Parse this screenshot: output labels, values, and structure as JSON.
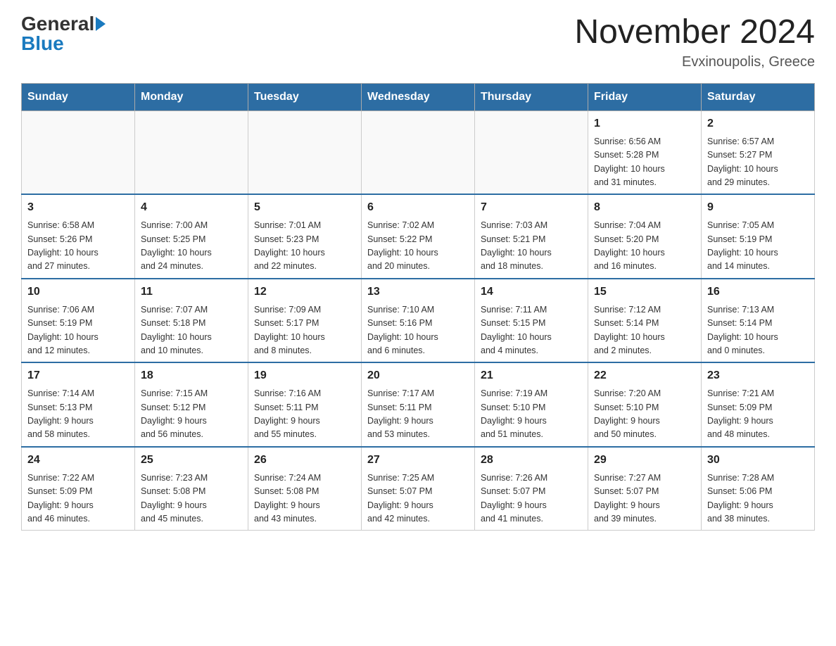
{
  "header": {
    "logo_general": "General",
    "logo_blue": "Blue",
    "month_year": "November 2024",
    "location": "Evxinoupolis, Greece"
  },
  "weekdays": [
    "Sunday",
    "Monday",
    "Tuesday",
    "Wednesday",
    "Thursday",
    "Friday",
    "Saturday"
  ],
  "weeks": [
    [
      {
        "day": "",
        "info": ""
      },
      {
        "day": "",
        "info": ""
      },
      {
        "day": "",
        "info": ""
      },
      {
        "day": "",
        "info": ""
      },
      {
        "day": "",
        "info": ""
      },
      {
        "day": "1",
        "info": "Sunrise: 6:56 AM\nSunset: 5:28 PM\nDaylight: 10 hours\nand 31 minutes."
      },
      {
        "day": "2",
        "info": "Sunrise: 6:57 AM\nSunset: 5:27 PM\nDaylight: 10 hours\nand 29 minutes."
      }
    ],
    [
      {
        "day": "3",
        "info": "Sunrise: 6:58 AM\nSunset: 5:26 PM\nDaylight: 10 hours\nand 27 minutes."
      },
      {
        "day": "4",
        "info": "Sunrise: 7:00 AM\nSunset: 5:25 PM\nDaylight: 10 hours\nand 24 minutes."
      },
      {
        "day": "5",
        "info": "Sunrise: 7:01 AM\nSunset: 5:23 PM\nDaylight: 10 hours\nand 22 minutes."
      },
      {
        "day": "6",
        "info": "Sunrise: 7:02 AM\nSunset: 5:22 PM\nDaylight: 10 hours\nand 20 minutes."
      },
      {
        "day": "7",
        "info": "Sunrise: 7:03 AM\nSunset: 5:21 PM\nDaylight: 10 hours\nand 18 minutes."
      },
      {
        "day": "8",
        "info": "Sunrise: 7:04 AM\nSunset: 5:20 PM\nDaylight: 10 hours\nand 16 minutes."
      },
      {
        "day": "9",
        "info": "Sunrise: 7:05 AM\nSunset: 5:19 PM\nDaylight: 10 hours\nand 14 minutes."
      }
    ],
    [
      {
        "day": "10",
        "info": "Sunrise: 7:06 AM\nSunset: 5:19 PM\nDaylight: 10 hours\nand 12 minutes."
      },
      {
        "day": "11",
        "info": "Sunrise: 7:07 AM\nSunset: 5:18 PM\nDaylight: 10 hours\nand 10 minutes."
      },
      {
        "day": "12",
        "info": "Sunrise: 7:09 AM\nSunset: 5:17 PM\nDaylight: 10 hours\nand 8 minutes."
      },
      {
        "day": "13",
        "info": "Sunrise: 7:10 AM\nSunset: 5:16 PM\nDaylight: 10 hours\nand 6 minutes."
      },
      {
        "day": "14",
        "info": "Sunrise: 7:11 AM\nSunset: 5:15 PM\nDaylight: 10 hours\nand 4 minutes."
      },
      {
        "day": "15",
        "info": "Sunrise: 7:12 AM\nSunset: 5:14 PM\nDaylight: 10 hours\nand 2 minutes."
      },
      {
        "day": "16",
        "info": "Sunrise: 7:13 AM\nSunset: 5:14 PM\nDaylight: 10 hours\nand 0 minutes."
      }
    ],
    [
      {
        "day": "17",
        "info": "Sunrise: 7:14 AM\nSunset: 5:13 PM\nDaylight: 9 hours\nand 58 minutes."
      },
      {
        "day": "18",
        "info": "Sunrise: 7:15 AM\nSunset: 5:12 PM\nDaylight: 9 hours\nand 56 minutes."
      },
      {
        "day": "19",
        "info": "Sunrise: 7:16 AM\nSunset: 5:11 PM\nDaylight: 9 hours\nand 55 minutes."
      },
      {
        "day": "20",
        "info": "Sunrise: 7:17 AM\nSunset: 5:11 PM\nDaylight: 9 hours\nand 53 minutes."
      },
      {
        "day": "21",
        "info": "Sunrise: 7:19 AM\nSunset: 5:10 PM\nDaylight: 9 hours\nand 51 minutes."
      },
      {
        "day": "22",
        "info": "Sunrise: 7:20 AM\nSunset: 5:10 PM\nDaylight: 9 hours\nand 50 minutes."
      },
      {
        "day": "23",
        "info": "Sunrise: 7:21 AM\nSunset: 5:09 PM\nDaylight: 9 hours\nand 48 minutes."
      }
    ],
    [
      {
        "day": "24",
        "info": "Sunrise: 7:22 AM\nSunset: 5:09 PM\nDaylight: 9 hours\nand 46 minutes."
      },
      {
        "day": "25",
        "info": "Sunrise: 7:23 AM\nSunset: 5:08 PM\nDaylight: 9 hours\nand 45 minutes."
      },
      {
        "day": "26",
        "info": "Sunrise: 7:24 AM\nSunset: 5:08 PM\nDaylight: 9 hours\nand 43 minutes."
      },
      {
        "day": "27",
        "info": "Sunrise: 7:25 AM\nSunset: 5:07 PM\nDaylight: 9 hours\nand 42 minutes."
      },
      {
        "day": "28",
        "info": "Sunrise: 7:26 AM\nSunset: 5:07 PM\nDaylight: 9 hours\nand 41 minutes."
      },
      {
        "day": "29",
        "info": "Sunrise: 7:27 AM\nSunset: 5:07 PM\nDaylight: 9 hours\nand 39 minutes."
      },
      {
        "day": "30",
        "info": "Sunrise: 7:28 AM\nSunset: 5:06 PM\nDaylight: 9 hours\nand 38 minutes."
      }
    ]
  ]
}
